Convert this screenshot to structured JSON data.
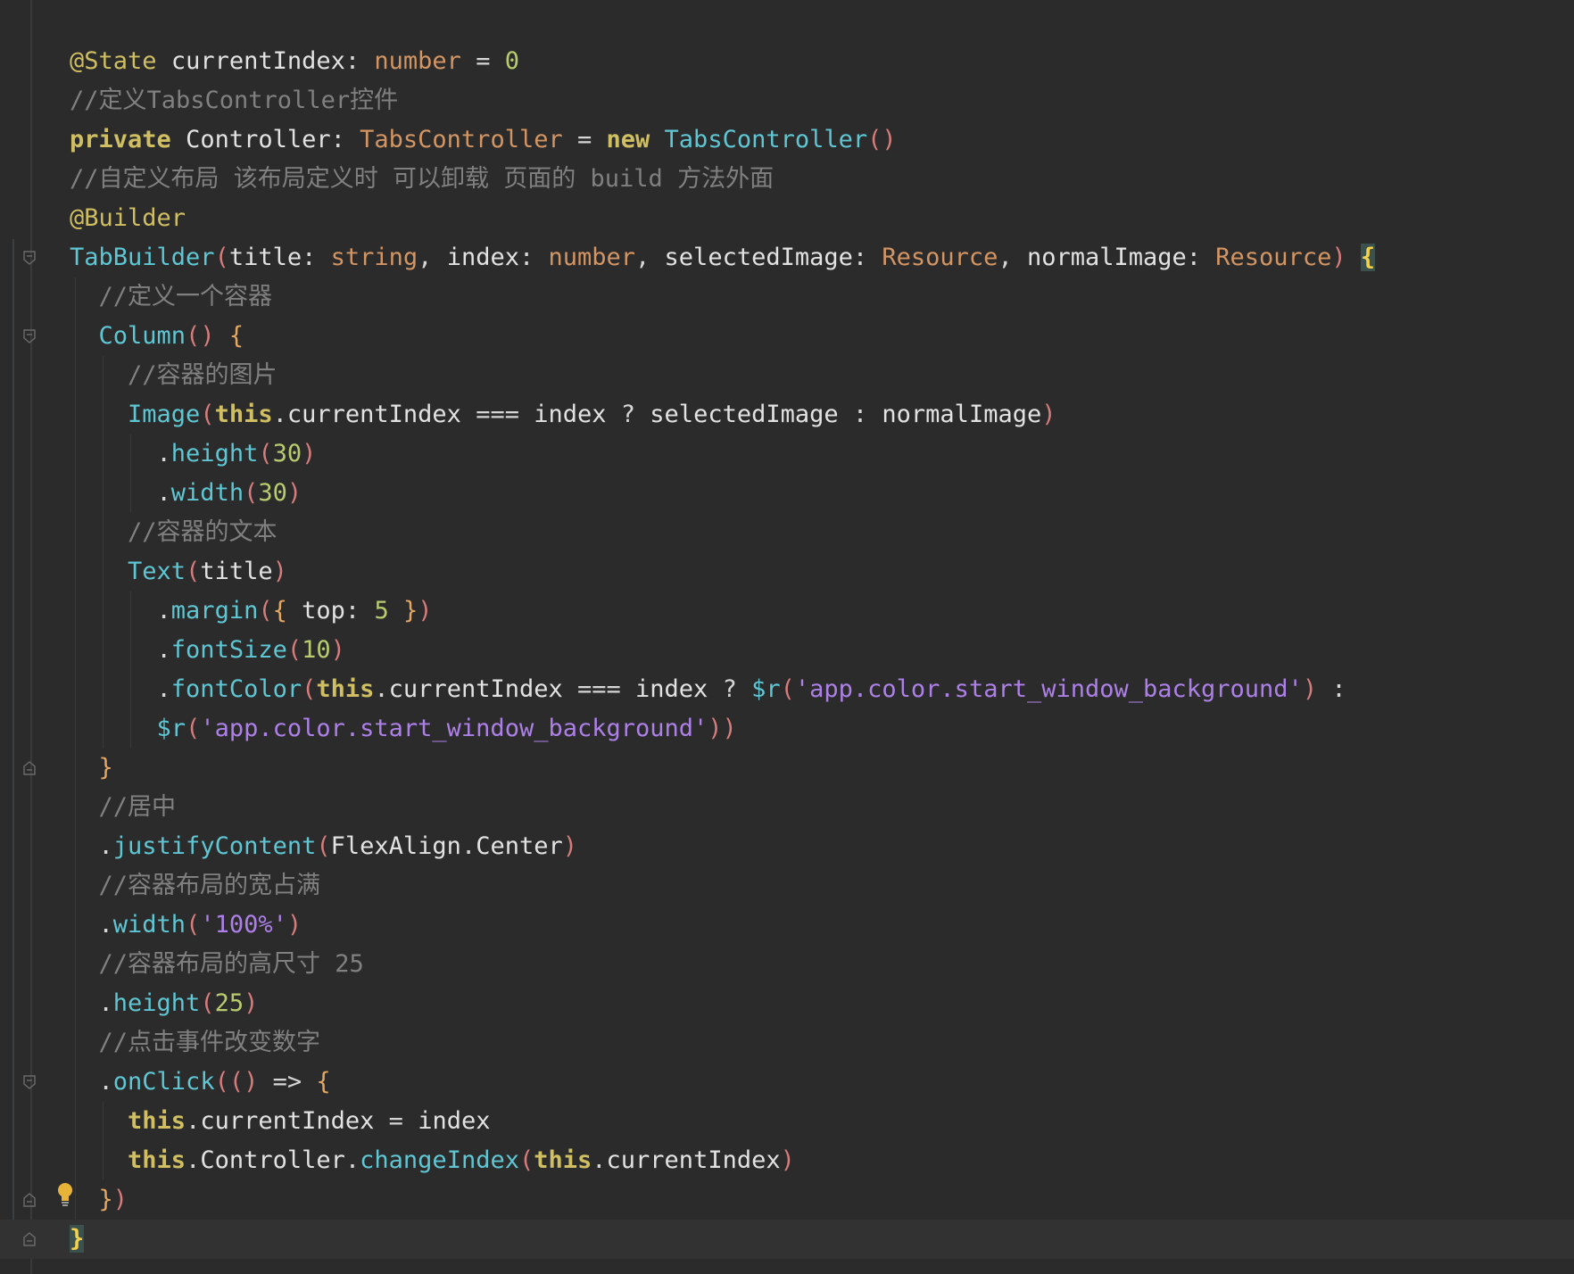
{
  "editor": {
    "lines": [
      [
        [
          "ann",
          "@State"
        ],
        [
          "op",
          " "
        ],
        [
          "id",
          "currentIndex"
        ],
        [
          "op",
          ": "
        ],
        [
          "ty",
          "number"
        ],
        [
          "op",
          " = "
        ],
        [
          "num",
          "0"
        ]
      ],
      [
        [
          "cm",
          "//定义TabsController控件"
        ]
      ],
      [
        [
          "kw",
          "private"
        ],
        [
          "op",
          " "
        ],
        [
          "id",
          "Controller"
        ],
        [
          "op",
          ": "
        ],
        [
          "ty",
          "TabsController"
        ],
        [
          "op",
          " = "
        ],
        [
          "kw",
          "new"
        ],
        [
          "op",
          " "
        ],
        [
          "fn",
          "TabsController"
        ],
        [
          "pr",
          "()"
        ]
      ],
      [
        [
          "cm",
          "//自定义布局 该布局定义时 可以卸载 页面的 build 方法外面"
        ]
      ],
      [
        [
          "ann",
          "@Builder"
        ]
      ],
      [
        [
          "fn",
          "TabBuilder"
        ],
        [
          "pr",
          "("
        ],
        [
          "id",
          "title"
        ],
        [
          "op",
          ": "
        ],
        [
          "ty",
          "string"
        ],
        [
          "op",
          ", "
        ],
        [
          "id",
          "index"
        ],
        [
          "op",
          ": "
        ],
        [
          "ty",
          "number"
        ],
        [
          "op",
          ", "
        ],
        [
          "id",
          "selectedImage"
        ],
        [
          "op",
          ": "
        ],
        [
          "ty",
          "Resource"
        ],
        [
          "op",
          ", "
        ],
        [
          "id",
          "normalImage"
        ],
        [
          "op",
          ": "
        ],
        [
          "ty",
          "Resource"
        ],
        [
          "pr",
          ")"
        ],
        [
          "op",
          " "
        ],
        [
          "cbr",
          "{"
        ]
      ],
      [
        [
          "op",
          "  "
        ],
        [
          "cm",
          "//定义一个容器"
        ]
      ],
      [
        [
          "op",
          "  "
        ],
        [
          "fn",
          "Column"
        ],
        [
          "pr",
          "()"
        ],
        [
          "op",
          " "
        ],
        [
          "pn",
          "{"
        ]
      ],
      [
        [
          "op",
          "    "
        ],
        [
          "cm",
          "//容器的图片"
        ]
      ],
      [
        [
          "op",
          "    "
        ],
        [
          "fn",
          "Image"
        ],
        [
          "pr",
          "("
        ],
        [
          "kw",
          "this"
        ],
        [
          "op",
          "."
        ],
        [
          "id",
          "currentIndex"
        ],
        [
          "op",
          " === "
        ],
        [
          "id",
          "index"
        ],
        [
          "op",
          " ? "
        ],
        [
          "id",
          "selectedImage"
        ],
        [
          "op",
          " : "
        ],
        [
          "id",
          "normalImage"
        ],
        [
          "pr",
          ")"
        ]
      ],
      [
        [
          "op",
          "      ."
        ],
        [
          "fn",
          "height"
        ],
        [
          "pr",
          "("
        ],
        [
          "num",
          "30"
        ],
        [
          "pr",
          ")"
        ]
      ],
      [
        [
          "op",
          "      ."
        ],
        [
          "fn",
          "width"
        ],
        [
          "pr",
          "("
        ],
        [
          "num",
          "30"
        ],
        [
          "pr",
          ")"
        ]
      ],
      [
        [
          "op",
          "    "
        ],
        [
          "cm",
          "//容器的文本"
        ]
      ],
      [
        [
          "op",
          "    "
        ],
        [
          "fn",
          "Text"
        ],
        [
          "pr",
          "("
        ],
        [
          "id",
          "title"
        ],
        [
          "pr",
          ")"
        ]
      ],
      [
        [
          "op",
          "      ."
        ],
        [
          "fn",
          "margin"
        ],
        [
          "pr",
          "("
        ],
        [
          "pn",
          "{"
        ],
        [
          "op",
          " "
        ],
        [
          "id",
          "top"
        ],
        [
          "op",
          ": "
        ],
        [
          "num",
          "5"
        ],
        [
          "op",
          " "
        ],
        [
          "pn",
          "}"
        ],
        [
          "pr",
          ")"
        ]
      ],
      [
        [
          "op",
          "      ."
        ],
        [
          "fn",
          "fontSize"
        ],
        [
          "pr",
          "("
        ],
        [
          "num",
          "10"
        ],
        [
          "pr",
          ")"
        ]
      ],
      [
        [
          "op",
          "      ."
        ],
        [
          "fn",
          "fontColor"
        ],
        [
          "pr",
          "("
        ],
        [
          "kw",
          "this"
        ],
        [
          "op",
          "."
        ],
        [
          "id",
          "currentIndex"
        ],
        [
          "op",
          " === "
        ],
        [
          "id",
          "index"
        ],
        [
          "op",
          " ? "
        ],
        [
          "fn",
          "$r"
        ],
        [
          "pr",
          "("
        ],
        [
          "str",
          "'app.color.start_window_background'"
        ],
        [
          "pr",
          ")"
        ],
        [
          "op",
          " :"
        ]
      ],
      [
        [
          "op",
          "      "
        ],
        [
          "fn",
          "$r"
        ],
        [
          "pr",
          "("
        ],
        [
          "str",
          "'app.color.start_window_background'"
        ],
        [
          "pr",
          "))"
        ]
      ],
      [
        [
          "op",
          "  "
        ],
        [
          "pn",
          "}"
        ]
      ],
      [
        [
          "op",
          "  "
        ],
        [
          "cm",
          "//居中"
        ]
      ],
      [
        [
          "op",
          "  ."
        ],
        [
          "fn",
          "justifyContent"
        ],
        [
          "pr",
          "("
        ],
        [
          "id",
          "FlexAlign"
        ],
        [
          "op",
          "."
        ],
        [
          "id",
          "Center"
        ],
        [
          "pr",
          ")"
        ]
      ],
      [
        [
          "op",
          "  "
        ],
        [
          "cm",
          "//容器布局的宽占满"
        ]
      ],
      [
        [
          "op",
          "  ."
        ],
        [
          "fn",
          "width"
        ],
        [
          "pr",
          "("
        ],
        [
          "str",
          "'100%'"
        ],
        [
          "pr",
          ")"
        ]
      ],
      [
        [
          "op",
          "  "
        ],
        [
          "cm",
          "//容器布局的高尺寸 25"
        ]
      ],
      [
        [
          "op",
          "  ."
        ],
        [
          "fn",
          "height"
        ],
        [
          "pr",
          "("
        ],
        [
          "num",
          "25"
        ],
        [
          "pr",
          ")"
        ]
      ],
      [
        [
          "op",
          "  "
        ],
        [
          "cm",
          "//点击事件改变数字"
        ]
      ],
      [
        [
          "op",
          "  ."
        ],
        [
          "fn",
          "onClick"
        ],
        [
          "pr",
          "(()"
        ],
        [
          "op",
          " => "
        ],
        [
          "pn",
          "{"
        ]
      ],
      [
        [
          "op",
          "    "
        ],
        [
          "kw",
          "this"
        ],
        [
          "op",
          "."
        ],
        [
          "id",
          "currentIndex"
        ],
        [
          "op",
          " = "
        ],
        [
          "id",
          "index"
        ]
      ],
      [
        [
          "op",
          "    "
        ],
        [
          "kw",
          "this"
        ],
        [
          "op",
          "."
        ],
        [
          "id",
          "Controller"
        ],
        [
          "op",
          "."
        ],
        [
          "fn",
          "changeIndex"
        ],
        [
          "pr",
          "("
        ],
        [
          "kw",
          "this"
        ],
        [
          "op",
          "."
        ],
        [
          "id",
          "currentIndex"
        ],
        [
          "pr",
          ")"
        ]
      ],
      [
        [
          "op",
          "  "
        ],
        [
          "pn",
          "}"
        ],
        [
          "pr",
          ")"
        ]
      ],
      [
        [
          "cbr",
          "}"
        ]
      ]
    ]
  }
}
